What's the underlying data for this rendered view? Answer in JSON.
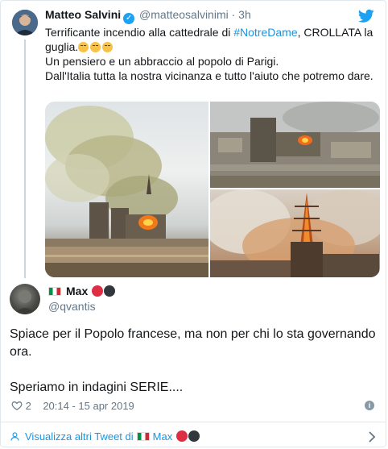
{
  "quoted_tweet": {
    "author_name": "Matteo Salvini",
    "handle": "@matteosalvinimi",
    "separator": "·",
    "time": "3h",
    "text_line1_before": "Terrificante incendio alla cattedrale di ",
    "hashtag": "#NotreDame",
    "text_line1_after": ", CROLLATA la guglia.",
    "text_line2": "Un pensiero e un abbraccio al popolo di Parigi.",
    "text_line3": "Dall'Italia tutta la nostra vicinanza e tutto l'aiuto che potremo dare.",
    "emoji_count": 3
  },
  "reply_tweet": {
    "author_name": "Max",
    "handle": "@qvantis",
    "text_paragraph1": "Spiace per il Popolo francese, ma non per chi lo sta governando ora.",
    "text_paragraph2": "Speriamo in indagini SERIE....",
    "like_count": "2",
    "timestamp": "20:14 - 15 apr 2019"
  },
  "footer": {
    "prefix": "Visualizza altri Tweet di",
    "name": "Max"
  },
  "colors": {
    "link": "#1b95e0",
    "twitter_blue": "#1da1f2",
    "muted": "#657786",
    "border": "#e1e8ed"
  }
}
